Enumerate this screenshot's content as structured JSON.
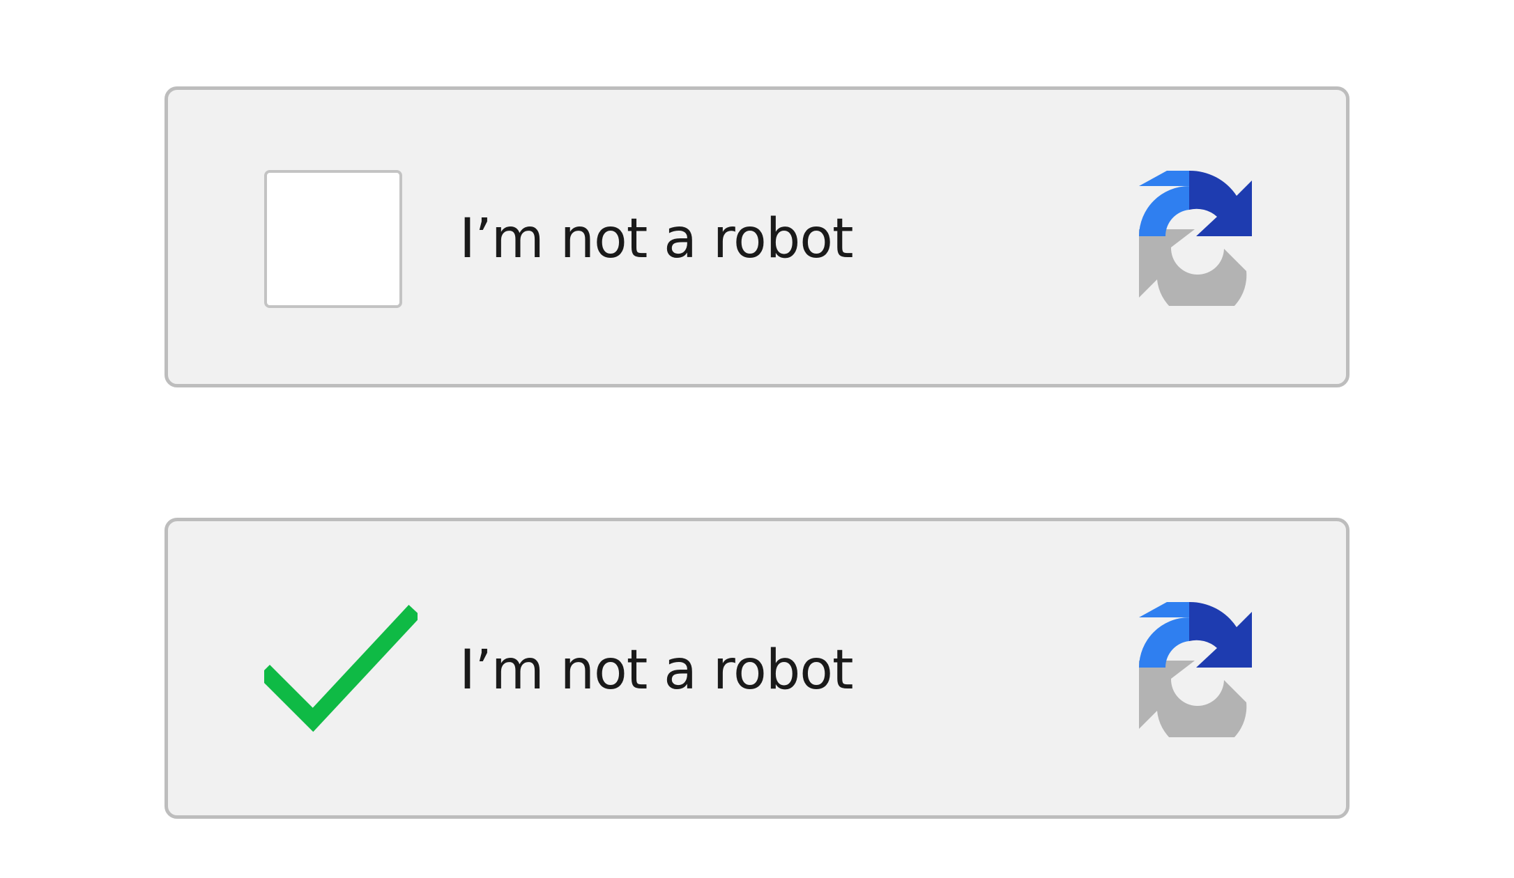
{
  "captchas": [
    {
      "state": "unchecked",
      "label": "I’m not a robot",
      "checked": false
    },
    {
      "state": "checked",
      "label": "I’m not a robot",
      "checked": true
    }
  ],
  "icons": {
    "logo": "recaptcha-logo-icon",
    "check": "checkmark-icon"
  },
  "colors": {
    "box_background": "#f1f1f1",
    "box_border": "#bdbdbd",
    "checkbox_background": "#ffffff",
    "checkbox_border": "#c3c3c3",
    "check_green": "#0fba45",
    "logo_light_blue": "#2f7ff0",
    "logo_dark_blue": "#1e3cb0",
    "logo_gray": "#b3b3b3",
    "text": "#1a1a1a"
  }
}
